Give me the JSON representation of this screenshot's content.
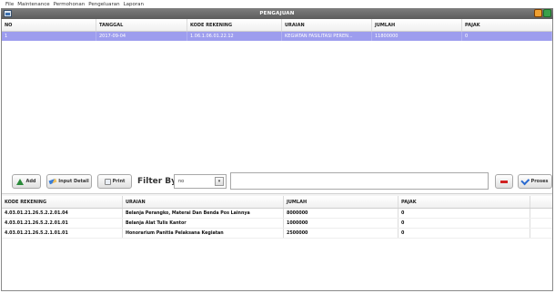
{
  "menu": [
    "File",
    "Maintenance",
    "Permohonan",
    "Pengeluaran",
    "Laporan"
  ],
  "window": {
    "title": "PENGAJUAN"
  },
  "top_table": {
    "columns": [
      "NO",
      "TANGGAL",
      "KODE REKENING",
      "URAIAN",
      "JUMLAH",
      "PAJAK"
    ],
    "rows": [
      [
        "1",
        "2017-09-04",
        "1.06.1.06.01.22.12",
        "KEGIATAN FASILITASI PEREN...",
        "11800000",
        "0"
      ]
    ]
  },
  "toolbar": {
    "add_label": "Add",
    "input_detail_label": "Input Detail",
    "print_label": "Print",
    "filter_by_label": "Filter By",
    "filter_select_value": "no",
    "filter_input_value": "",
    "proses_label": "Proses"
  },
  "bottom_table": {
    "columns": [
      "KODE REKENING",
      "URAIAN",
      "JUMLAH",
      "PAJAK",
      ""
    ],
    "rows": [
      [
        "4.03.01.21.26.5.2.2.01.04",
        "Belanja Perangko, Materai Dan Benda Pos Lainnya",
        "8000000",
        "0",
        ""
      ],
      [
        "4.03.01.21.26.5.2.2.01.01",
        "Belanja Alat Tulis Kantor",
        "1000000",
        "0",
        ""
      ],
      [
        "4.03.01.21.26.5.2.1.01.01",
        "Honorarium Panitia Pelaksana Kegiatan",
        "2500000",
        "0",
        ""
      ]
    ]
  },
  "colors": {
    "selected_row": "#9d9dee",
    "titlebar": "#6b6b6b"
  }
}
